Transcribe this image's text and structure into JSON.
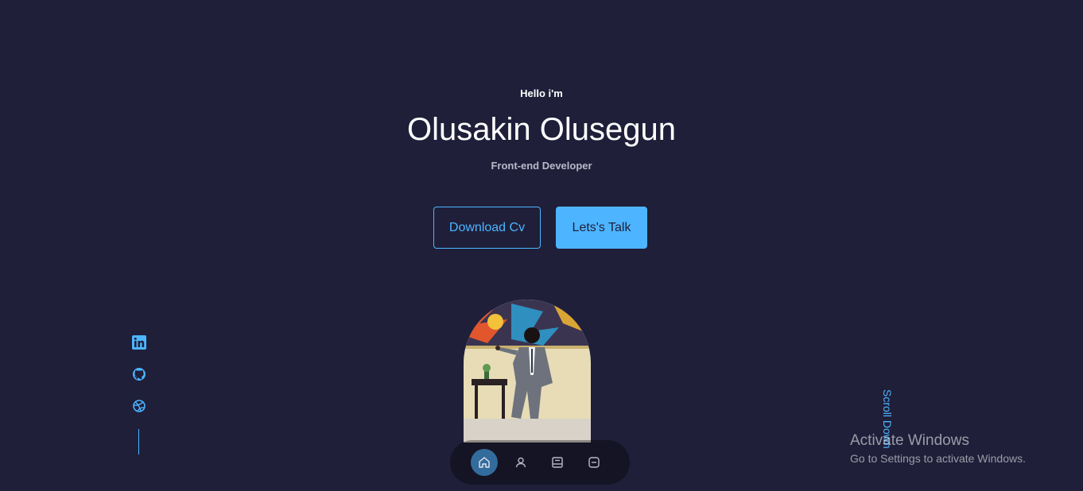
{
  "header": {
    "greeting": "Hello i'm",
    "name": "Olusakin Olusegun",
    "role": "Front-end Developer"
  },
  "cta": {
    "download_label": "Download Cv",
    "talk_label": "Lets's Talk"
  },
  "socials": [
    {
      "icon": "linkedin-icon"
    },
    {
      "icon": "github-icon"
    },
    {
      "icon": "dribbble-icon"
    }
  ],
  "scroll_label": "Scroll Down",
  "nav": [
    {
      "icon": "home-icon",
      "active": true
    },
    {
      "icon": "user-icon",
      "active": false
    },
    {
      "icon": "book-icon",
      "active": false
    },
    {
      "icon": "message-icon",
      "active": false
    }
  ],
  "watermark": {
    "title": "Activate Windows",
    "subtitle": "Go to Settings to activate Windows."
  },
  "colors": {
    "background": "#1f1f3a",
    "accent": "#4db5ff",
    "text": "#ffffff",
    "muted": "#b9b9c9"
  }
}
